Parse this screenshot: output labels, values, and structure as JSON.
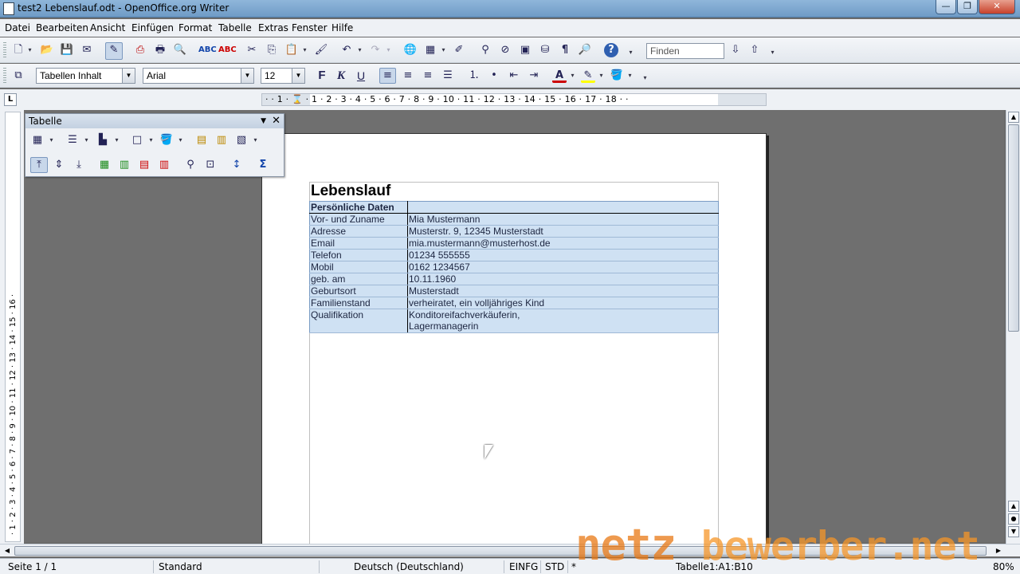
{
  "window": {
    "title": "test2 Lebenslauf.odt - OpenOffice.org Writer",
    "buttons": {
      "minimize": "—",
      "restore": "❐",
      "close": "✕"
    }
  },
  "menu": [
    "Datei",
    "Bearbeiten",
    "Ansicht",
    "Einfügen",
    "Format",
    "Tabelle",
    "Extras",
    "Fenster",
    "Hilfe"
  ],
  "toolbar": {
    "find_placeholder": "Finden",
    "paragraph_style": "Tabellen Inhalt",
    "font_name": "Arial",
    "font_size": "12",
    "bold": "F",
    "italic": "K",
    "underline": "U"
  },
  "ruler": {
    "horizontal": "· · 1 · ⌛ · 1 · 2 · 3 · 4 · 5 · 6 · 7 · 8 · 9 · 10 · 11 · 12 · 13 · 14 · 15 · 16 · 17 · 18 · ·",
    "vertical": "· 1 · 2 · 3 · 4 · 5 · 6 · 7 · 8 · 9 · 10 · 11 · 12 · 13 · 14 · 15 · 16 ·"
  },
  "table_toolbar": {
    "title": "Tabelle"
  },
  "document": {
    "title": "Lebenslauf",
    "section_header": "Persönliche Daten",
    "rows": [
      {
        "label": "Vor- und Zuname",
        "value": "Mia Mustermann"
      },
      {
        "label": "Adresse",
        "value": "Musterstr. 9, 12345 Musterstadt"
      },
      {
        "label": "Email",
        "value": "mia.mustermann@musterhost.de"
      },
      {
        "label": "Telefon",
        "value": "01234 555555"
      },
      {
        "label": "Mobil",
        "value": "0162 1234567"
      },
      {
        "label": "geb. am",
        "value": "10.11.1960"
      },
      {
        "label": "Geburtsort",
        "value": "Musterstadt"
      },
      {
        "label": "Familienstand",
        "value": "verheiratet, ein volljähriges Kind"
      },
      {
        "label": "Qualifikation",
        "value": "Konditoreifachverkäuferin,"
      },
      {
        "label": "",
        "value": "Lagermanagerin"
      }
    ]
  },
  "status": {
    "page": "Seite 1 / 1",
    "style": "Standard",
    "language": "Deutsch (Deutschland)",
    "insert_mode": "EINFG",
    "selection_mode": "STD",
    "modified": "*",
    "cell": "Tabelle1:A1:B10",
    "zoom": "80%"
  },
  "watermark": {
    "part1": "netz",
    "part2": "bewerber.net"
  }
}
